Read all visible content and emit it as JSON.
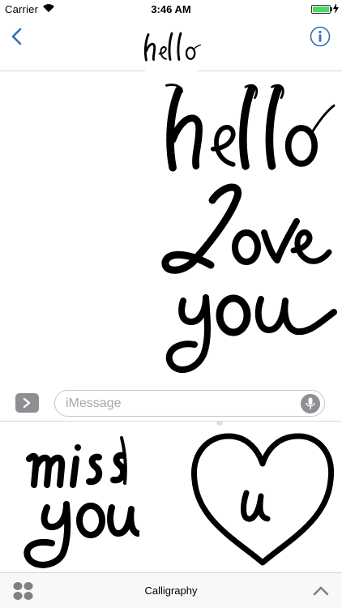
{
  "status_bar": {
    "carrier": "Carrier",
    "time": "3:46 AM",
    "battery_level": 1.0,
    "battery_color": "#4cd964"
  },
  "nav": {
    "back_icon": "chevron-left-icon",
    "info_icon": "info-icon",
    "contact_avatar_sticker": "hello",
    "accent_color": "#2f6fb7"
  },
  "transcript": {
    "stickers": [
      {
        "sticker": "hello"
      },
      {
        "sticker": "love you"
      }
    ]
  },
  "compose": {
    "placeholder": "iMessage",
    "value": "",
    "apps_icon": "chevron-right-icon",
    "mic_icon": "microphone-icon"
  },
  "drawer": {
    "stickers": [
      {
        "sticker": "miss you"
      },
      {
        "sticker": "heart u"
      }
    ]
  },
  "bottom_bar": {
    "title": "Calligraphy",
    "grid_icon": "app-grid-icon",
    "expand_icon": "chevron-up-icon"
  }
}
